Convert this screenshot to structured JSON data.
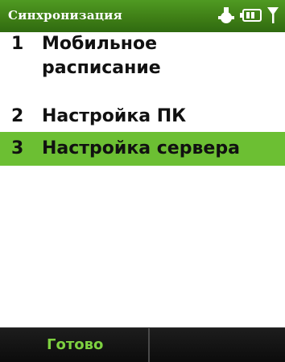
{
  "window": {
    "title": "Синхронизация"
  },
  "status_icons": [
    "sync-icon",
    "battery-icon",
    "signal-icon"
  ],
  "menu": {
    "items": [
      {
        "number": "1",
        "label": "Мобильное расписание",
        "selected": false
      },
      {
        "number": "2",
        "label": "Настройка ПК",
        "selected": false
      },
      {
        "number": "3",
        "label": "Настройка сервера",
        "selected": true
      }
    ]
  },
  "softkeys": {
    "left": "Готово",
    "right": ""
  },
  "colors": {
    "titlebar": "#3f7f16",
    "selection": "#6cbf33",
    "softkey_text": "#7dd040",
    "softkey_bar": "#111111"
  }
}
